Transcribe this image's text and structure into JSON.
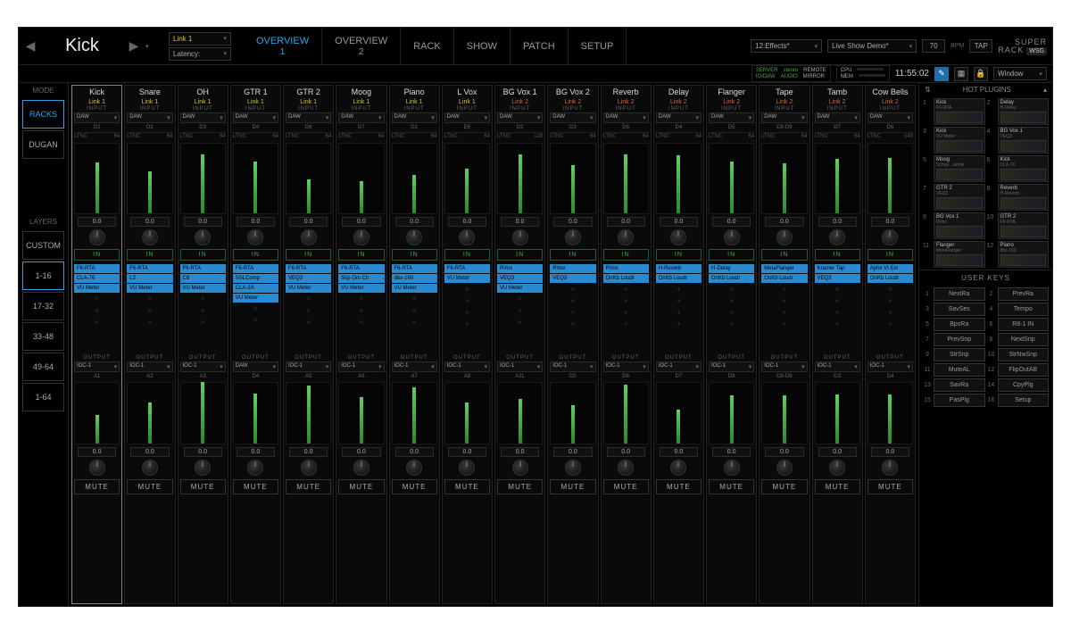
{
  "header": {
    "selected_channel": "Kick",
    "link_dd": "Link 1",
    "latency_dd": "Latency:",
    "tabs": [
      {
        "label": "OVERVIEW",
        "sub": "1",
        "active": true
      },
      {
        "label": "OVERVIEW",
        "sub": "2",
        "active": false
      },
      {
        "label": "RACK",
        "sub": "",
        "active": false
      },
      {
        "label": "SHOW",
        "sub": "",
        "active": false
      },
      {
        "label": "PATCH",
        "sub": "",
        "active": false
      },
      {
        "label": "SETUP",
        "sub": "",
        "active": false
      }
    ],
    "scene_dd": "12:Effects*",
    "session_dd": "Live Show Demo*",
    "bpm_val": "70",
    "bpm_label": "BPM",
    "tap_label": "TAP",
    "status": {
      "server": "SERVER",
      "stereo": "stereo",
      "remote": "REMOTE",
      "iodaw": "IO/DAW",
      "audio": "AUDIO",
      "mirror": "MIRROR",
      "cpu": "CPU",
      "mem": "MEM"
    },
    "clock": "11:55:02",
    "brand_top": "SUPER",
    "brand_bot": "RACK",
    "brand_badge": "WSG",
    "window_dd": "Window"
  },
  "left": {
    "mode_label": "MODE",
    "modes": [
      {
        "label": "RACKS",
        "active": true
      },
      {
        "label": "DUGAN",
        "active": false
      }
    ],
    "layers_label": "LAYERS",
    "layers": [
      {
        "label": "CUSTOM",
        "sel": false
      },
      {
        "label": "1-16",
        "sel": true
      },
      {
        "label": "17-32",
        "sel": false
      },
      {
        "label": "33-48",
        "sel": false
      },
      {
        "label": "49-64",
        "sel": false
      },
      {
        "label": "1-64",
        "sel": false
      }
    ]
  },
  "common": {
    "input_label": "INPUT",
    "output_label": "OUTPUT",
    "daw_label": "DAW",
    "ltnc_label": "LTNC",
    "in_btn": "IN",
    "mute_btn": "MUTE",
    "db_zero": "0.0"
  },
  "channels": [
    {
      "name": "Kick",
      "link": "Link 1",
      "linkClass": "link1",
      "in_dd": "DAW",
      "in_sub": "D2",
      "ltnc": "64",
      "plugins": [
        "F6-RTA",
        "CLA-76",
        "VU Meter"
      ],
      "out_dd": "IOC-1",
      "out_sub": "A1",
      "selected": true
    },
    {
      "name": "Snare",
      "link": "Link 1",
      "linkClass": "link1",
      "in_dd": "DAW",
      "in_sub": "D2",
      "ltnc": "64",
      "plugins": [
        "F6-RTA",
        "L2",
        "VU Meter"
      ],
      "out_dd": "IOC-1",
      "out_sub": "A2"
    },
    {
      "name": "OH",
      "link": "Link 1",
      "linkClass": "link1",
      "in_dd": "DAW",
      "in_sub": "D3",
      "ltnc": "64",
      "plugins": [
        "F6-RTA",
        "C6",
        "VU Meter"
      ],
      "out_dd": "IOC-1",
      "out_sub": "A3"
    },
    {
      "name": "GTR 1",
      "link": "Link 1",
      "linkClass": "link1",
      "in_dd": "DAW",
      "in_sub": "D4",
      "ltnc": "64",
      "plugins": [
        "F6-RTA",
        "SSLComp",
        "CLA-2A",
        "VU Meter"
      ],
      "out_dd": "DAW",
      "out_sub": "D4"
    },
    {
      "name": "GTR 2",
      "link": "Link 1",
      "linkClass": "link1",
      "in_dd": "DAW",
      "in_sub": "D6",
      "ltnc": "64",
      "plugins": [
        "F6-RTA",
        "VEQ3",
        "VU Meter"
      ],
      "out_dd": "IOC-1",
      "out_sub": "A5"
    },
    {
      "name": "Moog",
      "link": "Link 1",
      "linkClass": "link1",
      "in_dd": "DAW",
      "in_sub": "D7",
      "ltnc": "64",
      "plugins": [
        "F6-RTA",
        "Scp Om Ch",
        "VU Meter"
      ],
      "out_dd": "IOC-1",
      "out_sub": "A6"
    },
    {
      "name": "Piano",
      "link": "Link 1",
      "linkClass": "link1",
      "in_dd": "DAW",
      "in_sub": "D2",
      "ltnc": "64",
      "plugins": [
        "F6-RTA",
        "dbx-160",
        "VU Meter"
      ],
      "out_dd": "IOC-1",
      "out_sub": "A7"
    },
    {
      "name": "L Vox",
      "link": "Link 1",
      "linkClass": "link1",
      "in_dd": "DAW",
      "in_sub": "D5",
      "ltnc": "64",
      "plugins": [
        "F6-RTA",
        "VU Meter"
      ],
      "out_dd": "IOC-1",
      "out_sub": "A8"
    },
    {
      "name": "BG Vox 1",
      "link": "Link 2",
      "linkClass": "link2",
      "in_dd": "DAW",
      "in_sub": "D2",
      "ltnc": "128",
      "plugins": [
        "RVox",
        "VEQ3",
        "VU Meter"
      ],
      "out_dd": "IOC-1",
      "out_sub": "A2L"
    },
    {
      "name": "BG Vox 2",
      "link": "Link 2",
      "linkClass": "link2",
      "in_dd": "DAW",
      "in_sub": "D3",
      "ltnc": "64",
      "plugins": [
        "RVox",
        "VEQ3"
      ],
      "out_dd": "IOC-1",
      "out_sub": "D5"
    },
    {
      "name": "Reverb",
      "link": "Link 2",
      "linkClass": "link2",
      "in_dd": "DAW",
      "in_sub": "D6",
      "ltnc": "64",
      "plugins": [
        "RVox",
        "OnKb Loudr"
      ],
      "out_dd": "IOC-1",
      "out_sub": "D6"
    },
    {
      "name": "Delay",
      "link": "Link 2",
      "linkClass": "link2",
      "in_dd": "DAW",
      "in_sub": "D4",
      "ltnc": "64",
      "plugins": [
        "H-Reverb",
        "OnKb Loudr"
      ],
      "out_dd": "IOC-1",
      "out_sub": "D7"
    },
    {
      "name": "Flanger",
      "link": "Link 2",
      "linkClass": "link2",
      "in_dd": "DAW",
      "in_sub": "D5",
      "ltnc": "64",
      "plugins": [
        "H-Delay",
        "OnKb Loudr"
      ],
      "out_dd": "IOC-1",
      "out_sub": "D8"
    },
    {
      "name": "Tape",
      "link": "Link 2",
      "linkClass": "link2",
      "in_dd": "DAW",
      "in_sub": "D8-D9",
      "ltnc": "64",
      "plugins": [
        "MetaFlanger",
        "OnKb Loudr"
      ],
      "out_dd": "IOC-1",
      "out_sub": "D8-D9"
    },
    {
      "name": "Tamb",
      "link": "Link 2",
      "linkClass": "link2",
      "in_dd": "DAW",
      "in_sub": "D7",
      "ltnc": "64",
      "plugins": [
        "Kramer Tap",
        "VEQ3"
      ],
      "out_dd": "IOC-1",
      "out_sub": "D3"
    },
    {
      "name": "Cow Bells",
      "link": "Link 2",
      "linkClass": "link2",
      "in_dd": "DAW",
      "in_sub": "D6",
      "ltnc": "149",
      "plugins": [
        "Aphx Vt Ext",
        "OnKb Loudr"
      ],
      "out_dd": "IOC-1",
      "out_sub": "D4"
    }
  ],
  "right": {
    "hot_label": "HOT PLUGINS",
    "hot": [
      {
        "n": "Kick",
        "p": "F6-RTA"
      },
      {
        "n": "Delay",
        "p": "H-Delay"
      },
      {
        "n": "Kick",
        "p": "VU Meter"
      },
      {
        "n": "BG Vox 1",
        "p": "VEQ3"
      },
      {
        "n": "Moog",
        "p": "Schep…annel"
      },
      {
        "n": "Kick",
        "p": "CLA-76"
      },
      {
        "n": "GTR 2",
        "p": "VEQ3"
      },
      {
        "n": "Reverb",
        "p": "H-Reverb"
      },
      {
        "n": "BG Vox 1",
        "p": "RVox"
      },
      {
        "n": "GTR 2",
        "p": "F6-RTA"
      },
      {
        "n": "Flanger",
        "p": "MetaFlanger"
      },
      {
        "n": "Piano",
        "p": "dbx-160"
      }
    ],
    "uk_label": "USER KEYS",
    "uk": [
      "NextRa",
      "PrevRa",
      "SavSes",
      "Tempo",
      "BpsRa",
      "R8-1 IN",
      "PrevSnp",
      "NextSnp",
      "StrSnp",
      "StrNwSnp",
      "MuteAL",
      "FlipOutAB",
      "SavRa",
      "CpyPlg",
      "PasPlg",
      "Setup"
    ]
  }
}
